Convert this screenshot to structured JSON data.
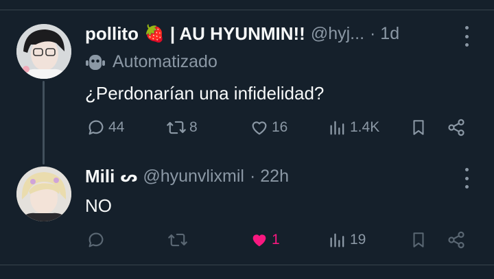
{
  "colors": {
    "background": "#15202b",
    "text": "#f7f9f9",
    "muted": "#8b98a5",
    "like": "#f91880",
    "divider": "#38444d"
  },
  "tweet": {
    "display_name": "pollito",
    "name_emoji": "🍓",
    "name_suffix": "| AU HYUNMIN!!",
    "handle": "@hyj...",
    "time": "· 1d",
    "automated_label": "Automatizado",
    "text": "¿Perdonarían una infidelidad?",
    "actions": {
      "replies": "44",
      "retweets": "8",
      "likes": "16",
      "views": "1.4K"
    }
  },
  "reply": {
    "display_name": "Mili",
    "name_symbol": "ᔕ",
    "handle": "@hyunvlixmil",
    "time": "· 22h",
    "text": "NO",
    "actions": {
      "replies": "",
      "retweets": "",
      "likes": "1",
      "views": "19"
    }
  }
}
